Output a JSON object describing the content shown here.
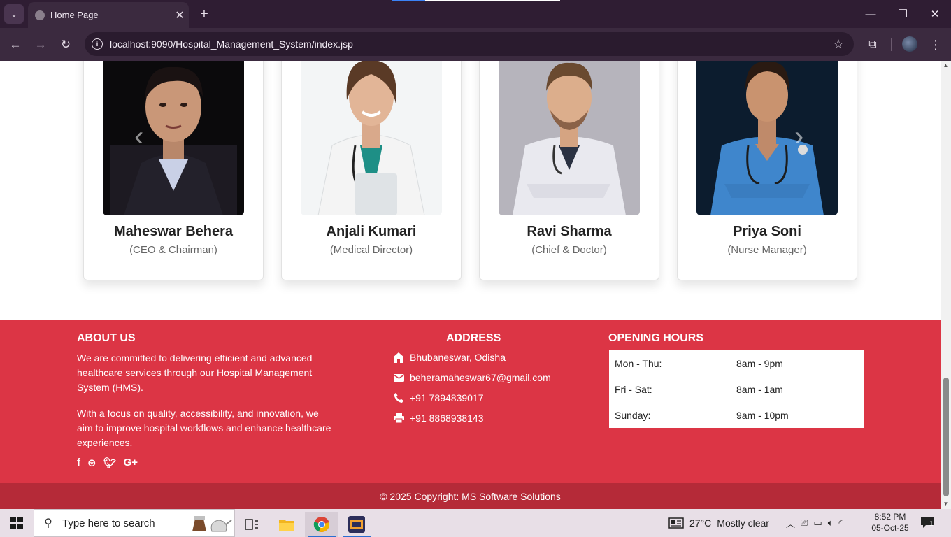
{
  "browser": {
    "tab_title": "Home Page",
    "url": "localhost:9090/Hospital_Management_System/index.jsp"
  },
  "team": [
    {
      "name": "Maheswar Behera",
      "role": "(CEO & Chairman)"
    },
    {
      "name": "Anjali Kumari",
      "role": "(Medical Director)"
    },
    {
      "name": "Ravi Sharma",
      "role": "(Chief & Doctor)"
    },
    {
      "name": "Priya Soni",
      "role": "(Nurse Manager)"
    }
  ],
  "footer": {
    "about": {
      "heading": "ABOUT US",
      "p1": "We are committed to delivering efficient and advanced healthcare services through our Hospital Management System (HMS).",
      "p2": "With a focus on quality, accessibility, and innovation, we aim to improve hospital workflows and enhance healthcare experiences."
    },
    "address": {
      "heading": "ADDRESS",
      "location": "Bhubaneswar, Odisha",
      "email": "beheramaheswar67@gmail.com",
      "phone": "+91 7894839017",
      "fax": "+91 8868938143"
    },
    "hours": {
      "heading": "OPENING HOURS",
      "rows": [
        {
          "day": "Mon - Thu:",
          "time": "8am - 9pm"
        },
        {
          "day": "Fri - Sat:",
          "time": "8am - 1am"
        },
        {
          "day": "Sunday:",
          "time": "9am - 10pm"
        }
      ]
    },
    "copyright": "© 2025 Copyright: MS Software Solutions"
  },
  "colors": {
    "footer_bg": "#dc3545",
    "copyright_bg": "#b52a38"
  },
  "taskbar": {
    "search_placeholder": "Type here to search",
    "weather_temp": "27°C",
    "weather_desc": "Mostly clear",
    "time": "8:52 PM",
    "date": "05-Oct-25",
    "notif_count": "1"
  }
}
